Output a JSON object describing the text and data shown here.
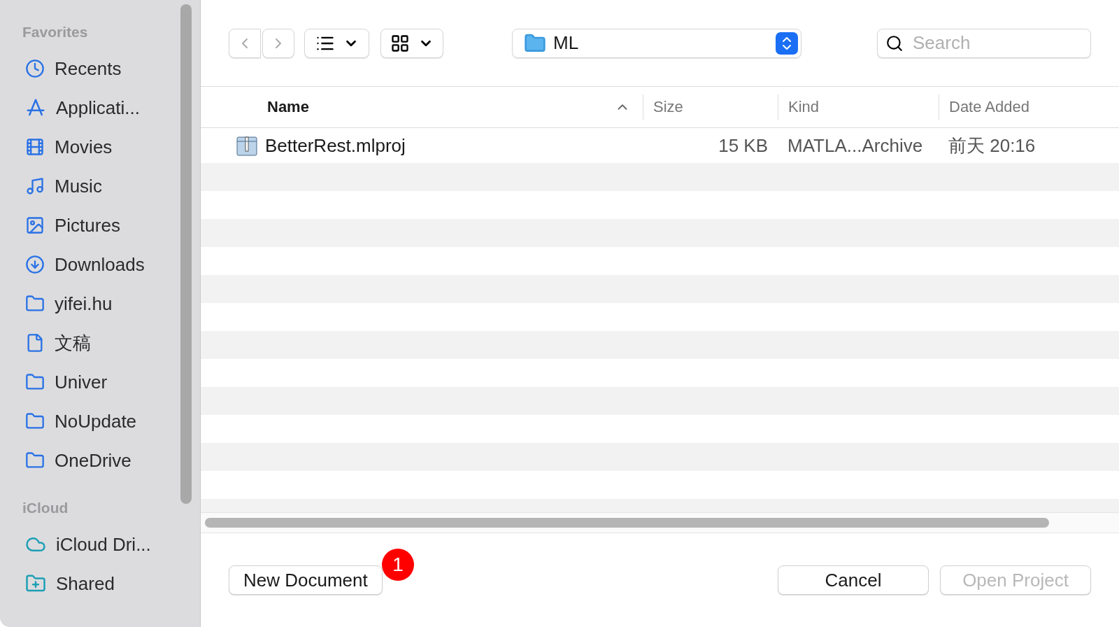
{
  "sidebar": {
    "sections": [
      {
        "title": "Favorites",
        "items": [
          {
            "label": "Recents"
          },
          {
            "label": "Applicati..."
          },
          {
            "label": "Movies"
          },
          {
            "label": "Music"
          },
          {
            "label": "Pictures"
          },
          {
            "label": "Downloads"
          },
          {
            "label": "yifei.hu"
          },
          {
            "label": "文稿"
          },
          {
            "label": "Univer"
          },
          {
            "label": "NoUpdate"
          },
          {
            "label": "OneDrive"
          }
        ]
      },
      {
        "title": "iCloud",
        "items": [
          {
            "label": "iCloud Dri..."
          },
          {
            "label": "Shared"
          }
        ]
      }
    ]
  },
  "toolbar": {
    "location": "ML",
    "search": {
      "placeholder": "Search"
    }
  },
  "table": {
    "columns": [
      {
        "label": "Name",
        "sorted": true
      },
      {
        "label": "Size",
        "sorted": false
      },
      {
        "label": "Kind",
        "sorted": false
      },
      {
        "label": "Date Added",
        "sorted": false
      }
    ],
    "rows": [
      {
        "name": "BetterRest.mlproj",
        "size": "15 KB",
        "kind": "MATLA...Archive",
        "date": "前天 20:16"
      }
    ]
  },
  "buttons": {
    "new_document": "New Document",
    "badge": "1",
    "cancel": "Cancel",
    "open": {
      "label": "Open Project",
      "disabled": true
    }
  }
}
